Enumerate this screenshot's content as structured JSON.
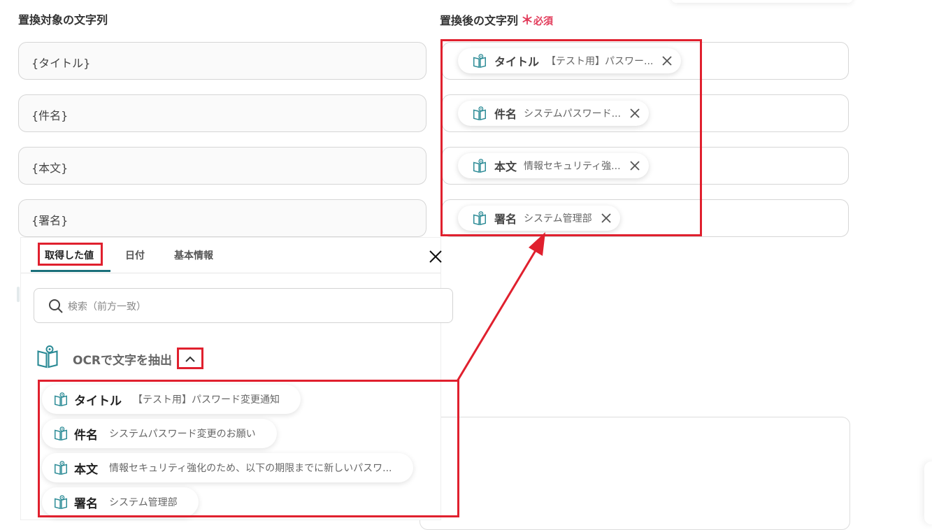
{
  "left": {
    "label": "置換対象の文字列",
    "fields": [
      "{タイトル}",
      "{件名}",
      "{本文}",
      "{署名}"
    ]
  },
  "right": {
    "label": "置換後の文字列",
    "required_mark": "＊",
    "required_label": "必須",
    "chips": [
      {
        "name": "タイトル",
        "value": "【テスト用】パスワー..."
      },
      {
        "name": "件名",
        "value": "システムパスワード..."
      },
      {
        "name": "本文",
        "value": "情報セキュリティ強..."
      },
      {
        "name": "署名",
        "value": "システム管理部"
      }
    ]
  },
  "picker": {
    "tabs": [
      "取得した値",
      "日付",
      "基本情報"
    ],
    "search_placeholder": "検索（前方一致）",
    "section_title": "OCRで文字を抽出",
    "items": [
      {
        "name": "タイトル",
        "value": "【テスト用】パスワード変更通知"
      },
      {
        "name": "件名",
        "value": "システムパスワード変更のお願い"
      },
      {
        "name": "本文",
        "value": "情報セキュリティ強化のため、以下の期限までに新しいパスワ..."
      },
      {
        "name": "署名",
        "value": "システム管理部"
      }
    ]
  },
  "colors": {
    "accent": "#1a6f7a",
    "highlight": "#e0202e",
    "icon": "#2a8a95"
  },
  "icons": {
    "ocr": "book-eye-icon",
    "close": "close-icon",
    "search": "search-icon",
    "collapse": "chevron-up-icon"
  }
}
